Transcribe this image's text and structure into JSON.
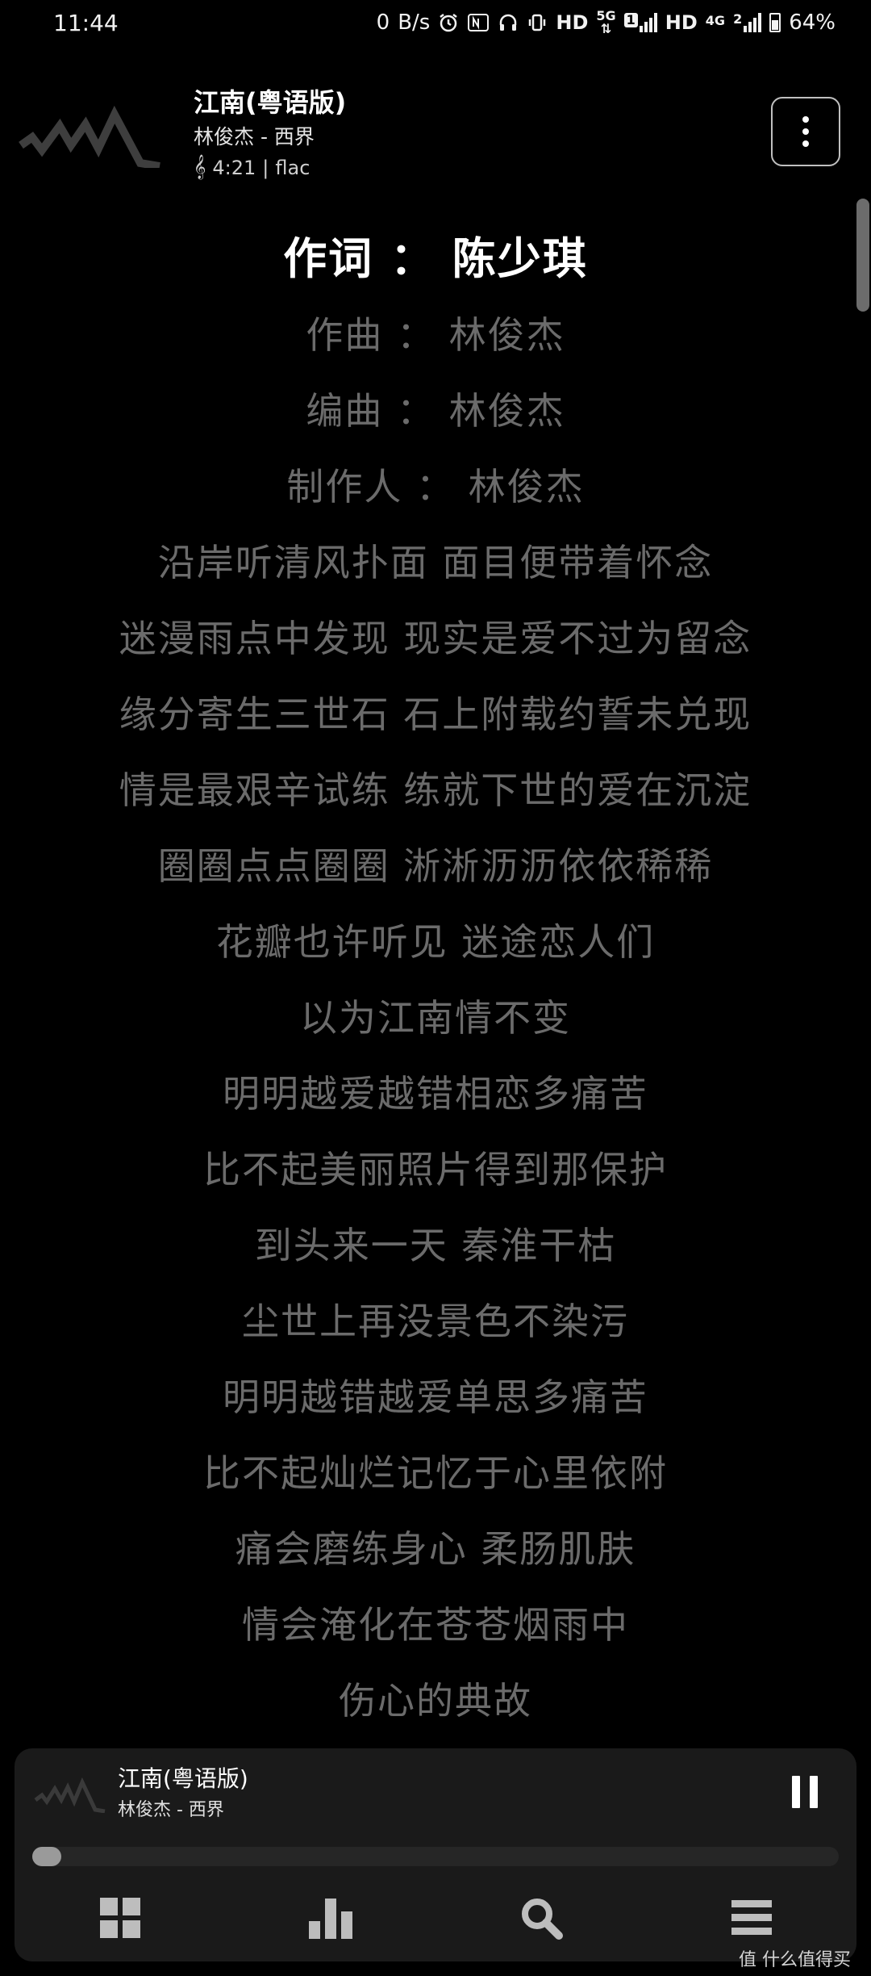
{
  "status_bar": {
    "time": "11:44",
    "net_speed_value": "0",
    "net_speed_unit": "B/s",
    "hd1": "HD",
    "net1": "5G",
    "sim1_badge": "1",
    "hd2": "HD",
    "net2": "4G",
    "sim2_badge": "2",
    "battery": "64%"
  },
  "header": {
    "title": "江南(粤语版)",
    "artist_line": "林俊杰 - 西界",
    "duration": "4:21",
    "format": "flac",
    "separator": "|"
  },
  "lyrics": [
    "作词 ： 陈少琪",
    "作曲 ： 林俊杰",
    "编曲 ： 林俊杰",
    "制作人 ： 林俊杰",
    "沿岸听清风扑面 面目便带着怀念",
    "迷漫雨点中发现 现实是爱不过为留念",
    "缘分寄生三世石 石上附载约誓未兑现",
    "情是最艰辛试练 练就下世的爱在沉淀",
    "圈圈点点圈圈 淅淅沥沥依依稀稀",
    "花瓣也许听见 迷途恋人们",
    "以为江南情不变",
    "明明越爱越错相恋多痛苦",
    "比不起美丽照片得到那保护",
    "到头来一天 秦淮干枯",
    "尘世上再没景色不染污",
    "明明越错越爱单思多痛苦",
    "比不起灿烂记忆于心里依附",
    "痛会磨练身心 柔肠肌肤",
    "情会淹化在苍苍烟雨中",
    "伤心的典故"
  ],
  "active_lyric_index": 0,
  "mini_player": {
    "title": "江南(粤语版)",
    "artist_line": "林俊杰 - 西界",
    "progress_fraction": 0.023
  },
  "nav": {
    "items": [
      "grid-icon",
      "bar-chart-icon",
      "search-icon",
      "list-icon"
    ]
  },
  "watermark": "值 什么值得买",
  "colors": {
    "background": "#000000",
    "lyric_inactive": "#6b6b6b",
    "lyric_active": "#ffffff",
    "player_bg": "#1a1a1a"
  }
}
